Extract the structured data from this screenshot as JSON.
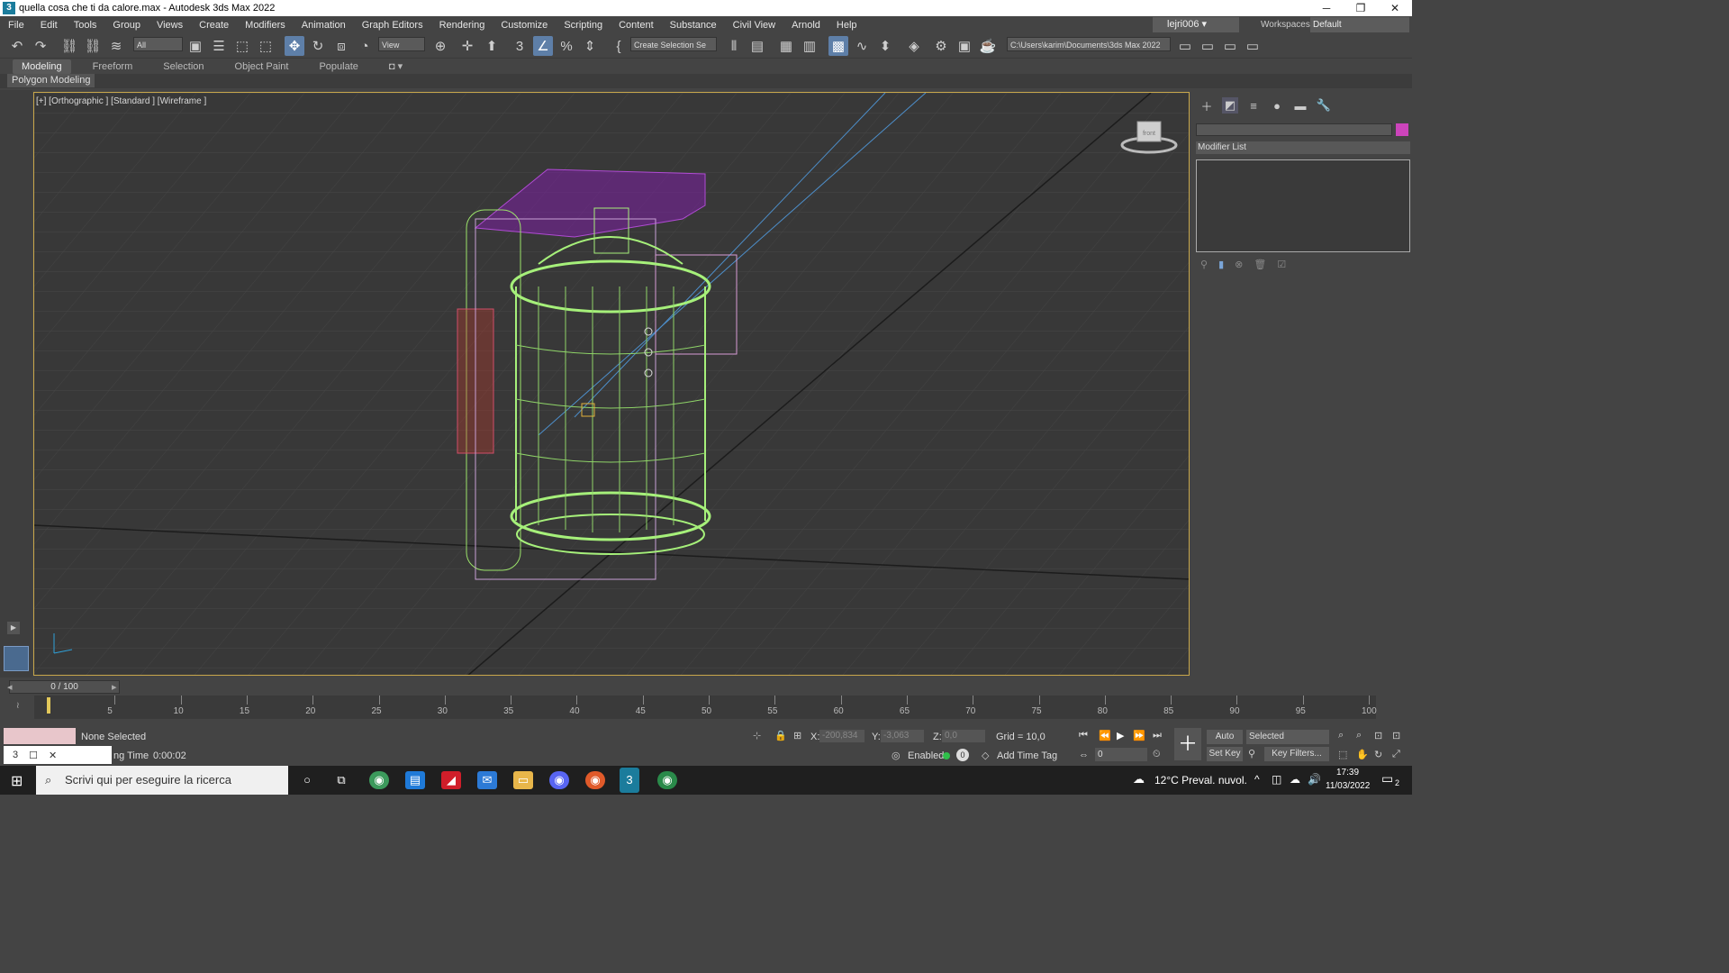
{
  "window": {
    "title": "quella cosa che ti da calore.max - Autodesk 3ds Max 2022",
    "minimize": "─",
    "restore": "❐",
    "close": "✕"
  },
  "menu": [
    "File",
    "Edit",
    "Tools",
    "Group",
    "Views",
    "Create",
    "Modifiers",
    "Animation",
    "Graph Editors",
    "Rendering",
    "Customize",
    "Scripting",
    "Content",
    "Substance",
    "Civil View",
    "Arnold",
    "Help"
  ],
  "user": {
    "name": "lejri006"
  },
  "workspaces": {
    "label": "Workspaces:",
    "value": "Default"
  },
  "toolbar": {
    "filter": "All",
    "refcoord": "View",
    "selset": "Create Selection Se",
    "path": "C:\\Users\\karim\\Documents\\3ds Max 2022"
  },
  "ribbon": {
    "tabs": [
      "Modeling",
      "Freeform",
      "Selection",
      "Object Paint",
      "Populate"
    ],
    "active": "Modeling",
    "panel": "Polygon Modeling"
  },
  "viewport": {
    "label": "[+] [Orthographic ] [Standard ] [Wireframe ]",
    "cube_label": "front"
  },
  "command_panel": {
    "modifier_list": "Modifier List",
    "accent": "#cc44bb"
  },
  "timeline": {
    "slider": "0 / 100",
    "ticks": [
      "0",
      "5",
      "10",
      "15",
      "20",
      "25",
      "30",
      "35",
      "40",
      "45",
      "50",
      "55",
      "60",
      "65",
      "70",
      "75",
      "80",
      "85",
      "90",
      "95",
      "100"
    ]
  },
  "status": {
    "selection": "None Selected",
    "time_label": "ng Time",
    "time_value": "0:00:02",
    "x_label": "X:",
    "x": "-200,834",
    "y_label": "Y:",
    "y": "-3,063",
    "z_label": "Z:",
    "z": "0,0",
    "grid": "Grid = 10,0",
    "enabled": "Enabled:",
    "timetag": "Add Time Tag",
    "autokey": "Auto Key",
    "setkey": "Set Key",
    "keymode": "Selected",
    "keyfilters": "Key Filters...",
    "frame": "0"
  },
  "taskbar": {
    "search": "Scrivi qui per eseguire la ricerca",
    "weather": "12°C  Preval. nuvol.",
    "time": "17:39",
    "date": "11/03/2022",
    "notif": "2"
  }
}
